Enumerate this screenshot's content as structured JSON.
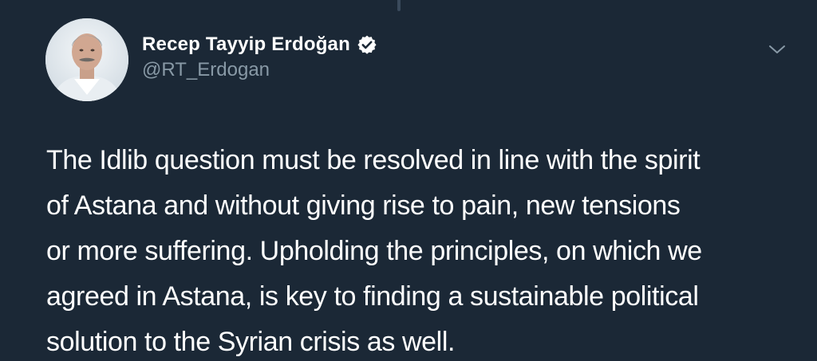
{
  "author": {
    "display_name": "Recep Tayyip Erdoğan",
    "handle": "@RT_Erdogan",
    "verified": true,
    "avatar_icon": "profile-photo"
  },
  "tweet": {
    "lines": [
      "The Idlib question must be resolved in line with the spirit",
      "of Astana and without giving rise to pain, new tensions",
      "or more suffering. Upholding the principles, on which we",
      "agreed in Astana, is key to finding a sustainable political",
      "solution to the Syrian crisis as well."
    ]
  },
  "menu": {
    "icon": "chevron-down-icon"
  },
  "colors": {
    "background": "#1b2836",
    "text_primary": "#ffffff",
    "text_secondary": "#8899a6",
    "verified_badge": "#ffffff"
  }
}
